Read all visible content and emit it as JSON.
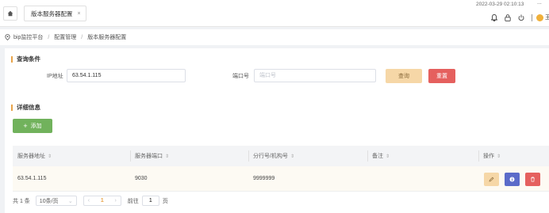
{
  "topbar": {
    "tab_label": "版本服务器配置",
    "tab_close": "×",
    "datetime": "2022-03-29 02:10:13",
    "more": "...",
    "username": "王卢"
  },
  "breadcrumb": {
    "items": [
      "bip监控平台",
      "配置管理",
      "版本服务器配置"
    ],
    "separator": "/"
  },
  "query": {
    "section_title": "查询条件",
    "ip_label": "IP地址",
    "ip_value": "63.54.1.115",
    "port_label": "端口号",
    "port_placeholder": "端口号",
    "query_button": "查询",
    "reset_button": "重置"
  },
  "detail": {
    "section_title": "详细信息",
    "add_button": "添加"
  },
  "table": {
    "columns": [
      "服务器地址",
      "服务器端口",
      "分行号/机构号",
      "备注",
      "操作"
    ],
    "rows": [
      {
        "address": "63.54.1.115",
        "port": "9030",
        "branch": "9999999",
        "remark": ""
      }
    ]
  },
  "pagination": {
    "total": "共 1 条",
    "page_size": "10条/页",
    "current_page": "1",
    "goto_label": "前往",
    "goto_value": "1",
    "page_suffix": "页"
  },
  "colors": {
    "accent": "#e8a44a",
    "query_button": "#f6d7a7",
    "danger": "#e5605e",
    "success": "#71b25c",
    "info": "#5b6bc9"
  },
  "icons": [
    "home-icon",
    "close-icon",
    "bell-icon",
    "lock-icon",
    "power-icon",
    "location-pin-icon",
    "plus-icon",
    "edit-icon",
    "info-icon",
    "trash-icon",
    "sort-icon",
    "chevron-down-icon",
    "chevron-left-icon",
    "chevron-right-icon"
  ]
}
